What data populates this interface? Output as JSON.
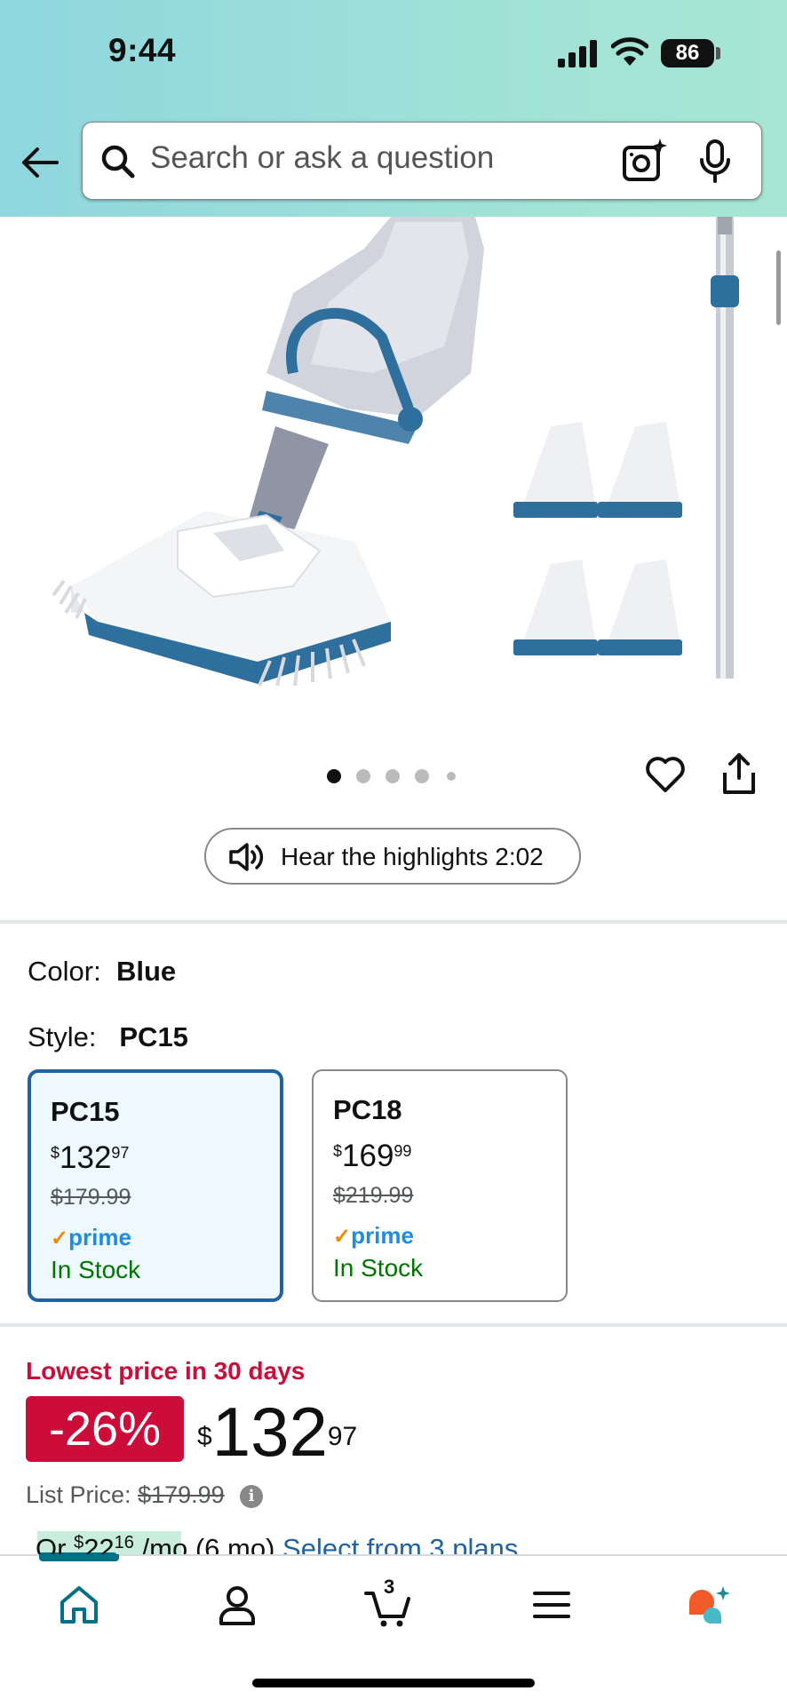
{
  "status_bar": {
    "time": "9:44",
    "battery": "86"
  },
  "search": {
    "placeholder": "Search or ask a question"
  },
  "carousel": {
    "dot_count": 5,
    "active_index": 0
  },
  "audio": {
    "label": "Hear the highlights 2:02"
  },
  "color": {
    "label": "Color:",
    "value": "Blue"
  },
  "style": {
    "label": "Style:",
    "value": "PC15",
    "options": [
      {
        "name": "PC15",
        "price_symbol": "$",
        "price_whole": "132",
        "price_cents": "97",
        "list_price": "$179.99",
        "prime": "prime",
        "stock": "In Stock",
        "selected": true
      },
      {
        "name": "PC18",
        "price_symbol": "$",
        "price_whole": "169",
        "price_cents": "99",
        "list_price": "$219.99",
        "prime": "prime",
        "stock": "In Stock",
        "selected": false
      }
    ]
  },
  "pricing": {
    "deal_label": "Lowest price in 30 days",
    "discount": "-26%",
    "symbol": "$",
    "whole": "132",
    "cents": "97",
    "list_label": "List Price:",
    "list_value": "$179.99",
    "info_glyph": "i",
    "monthly_prefix": "Or",
    "monthly_symbol": "$",
    "monthly_whole": "22",
    "monthly_cents": "16",
    "monthly_suffix": "/mo (6 mo)",
    "plans_link": "Select from 3 plans"
  },
  "bottom_nav": {
    "cart_count": "3",
    "items": [
      "home-icon",
      "account-icon",
      "cart-icon",
      "menu-icon",
      "rufus-icon"
    ]
  },
  "colors": {
    "accent": "#007185",
    "deal_red": "#cc0c39",
    "link_blue": "#2162a1",
    "stock_green": "#007600",
    "selected_border": "#2162a1"
  }
}
